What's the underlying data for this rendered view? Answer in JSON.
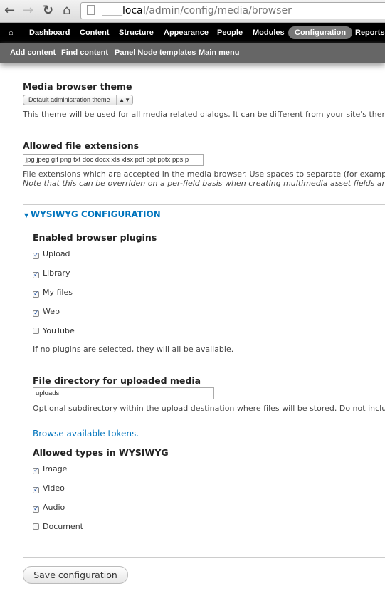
{
  "browser": {
    "url_prefix": "____",
    "url_host": "local",
    "url_path": "/admin/config/media/browser"
  },
  "toolbar": {
    "items": [
      "Dashboard",
      "Content",
      "Structure",
      "Appearance",
      "People",
      "Modules",
      "Configuration",
      "Reports"
    ],
    "active": "Configuration"
  },
  "shortcuts": [
    "Add content",
    "Find content",
    "Panel Node templates",
    "Main menu"
  ],
  "theme": {
    "label": "Media browser theme",
    "selected": "Default administration theme",
    "description": "This theme will be used for all media related dialogs. It can be different from your site's theme"
  },
  "extensions": {
    "label": "Allowed file extensions",
    "value": "jpg jpeg gif png txt doc docx xls xlsx pdf ppt pptx pps p",
    "description": "File extensions which are accepted in the media browser. Use spaces to separate (for example:",
    "note": "Note that this can be overriden on a per-field basis when creating multimedia asset fields and f"
  },
  "wysiwyg": {
    "legend": "WYSIWYG CONFIGURATION",
    "plugins_label": "Enabled browser plugins",
    "plugins": [
      {
        "label": "Upload",
        "checked": true
      },
      {
        "label": "Library",
        "checked": true
      },
      {
        "label": "My files",
        "checked": true
      },
      {
        "label": "Web",
        "checked": true
      },
      {
        "label": "YouTube",
        "checked": false
      }
    ],
    "plugins_note": "If no plugins are selected, they will all be available.",
    "dir_label": "File directory for uploaded media",
    "dir_value": "uploads",
    "dir_description": "Optional subdirectory within the upload destination where files will be stored. Do not include",
    "tokens_link": "Browse available tokens.",
    "types_label": "Allowed types in WYSIWYG",
    "types": [
      {
        "label": "Image",
        "checked": true
      },
      {
        "label": "Video",
        "checked": true
      },
      {
        "label": "Audio",
        "checked": true
      },
      {
        "label": "Document",
        "checked": false
      }
    ]
  },
  "save_label": "Save configuration"
}
